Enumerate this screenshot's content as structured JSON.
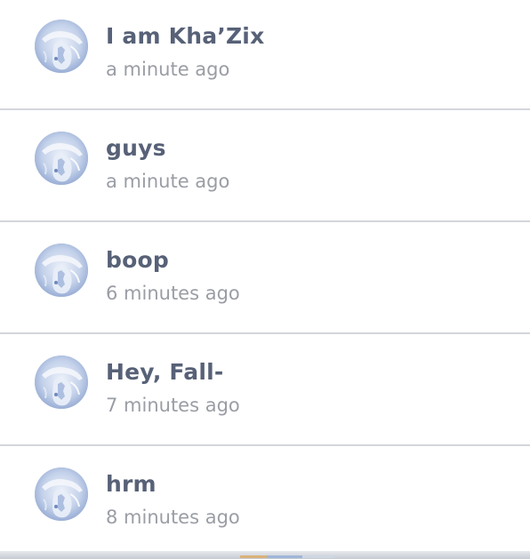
{
  "feed": {
    "items": [
      {
        "title": "I am Kha’Zix",
        "time": "a minute ago",
        "avatar_icon": "dragon-avatar-icon"
      },
      {
        "title": "guys",
        "time": "a minute ago",
        "avatar_icon": "dragon-avatar-icon"
      },
      {
        "title": "boop",
        "time": "6 minutes ago",
        "avatar_icon": "dragon-avatar-icon"
      },
      {
        "title": "Hey, Fall-",
        "time": "7 minutes ago",
        "avatar_icon": "dragon-avatar-icon"
      },
      {
        "title": "hrm",
        "time": "8 minutes ago",
        "avatar_icon": "dragon-avatar-icon"
      }
    ]
  },
  "colors": {
    "title": "#576177",
    "time": "#9a9da4",
    "divider": "#d3d6dc",
    "avatar_bg": "#c2cfe6"
  }
}
